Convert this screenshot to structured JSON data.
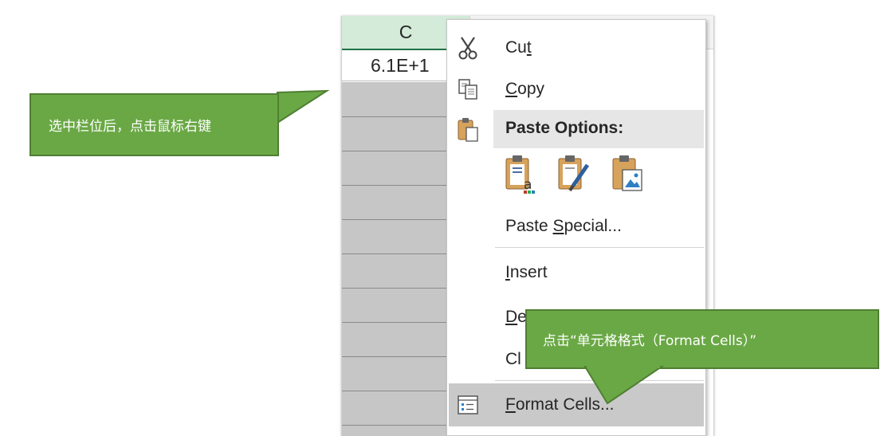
{
  "sheet": {
    "column_letter": "C",
    "cell_value": "6.1E+1"
  },
  "menu": {
    "cut": {
      "pre": "Cu",
      "key": "t",
      "post": ""
    },
    "copy": {
      "pre": "",
      "key": "C",
      "post": "opy"
    },
    "paste_options": "Paste Options:",
    "paste_special": {
      "pre": "Paste ",
      "key": "S",
      "post": "pecial..."
    },
    "insert": {
      "pre": "",
      "key": "I",
      "post": "nsert"
    },
    "delete": {
      "pre": "",
      "key": "D",
      "post": "e"
    },
    "clear": {
      "pre": "Cl",
      "key": "",
      "post": ""
    },
    "format_cells": {
      "pre": "",
      "key": "F",
      "post": "ormat Cells..."
    }
  },
  "callouts": {
    "right_click_hint": "选中栏位后，点击鼠标右键",
    "format_cells_hint": "点击“单元格格式（Format Cells）”"
  },
  "colors": {
    "header_green": "#d3ebd8",
    "excel_green": "#217346",
    "callout_green": "#6aa845",
    "menu_highlight": "#c9c9c9"
  },
  "icons": [
    "scissors-icon",
    "copy-icon",
    "paste-icon",
    "paste-text-icon",
    "paste-formatting-icon",
    "paste-picture-icon",
    "format-cells-icon"
  ]
}
